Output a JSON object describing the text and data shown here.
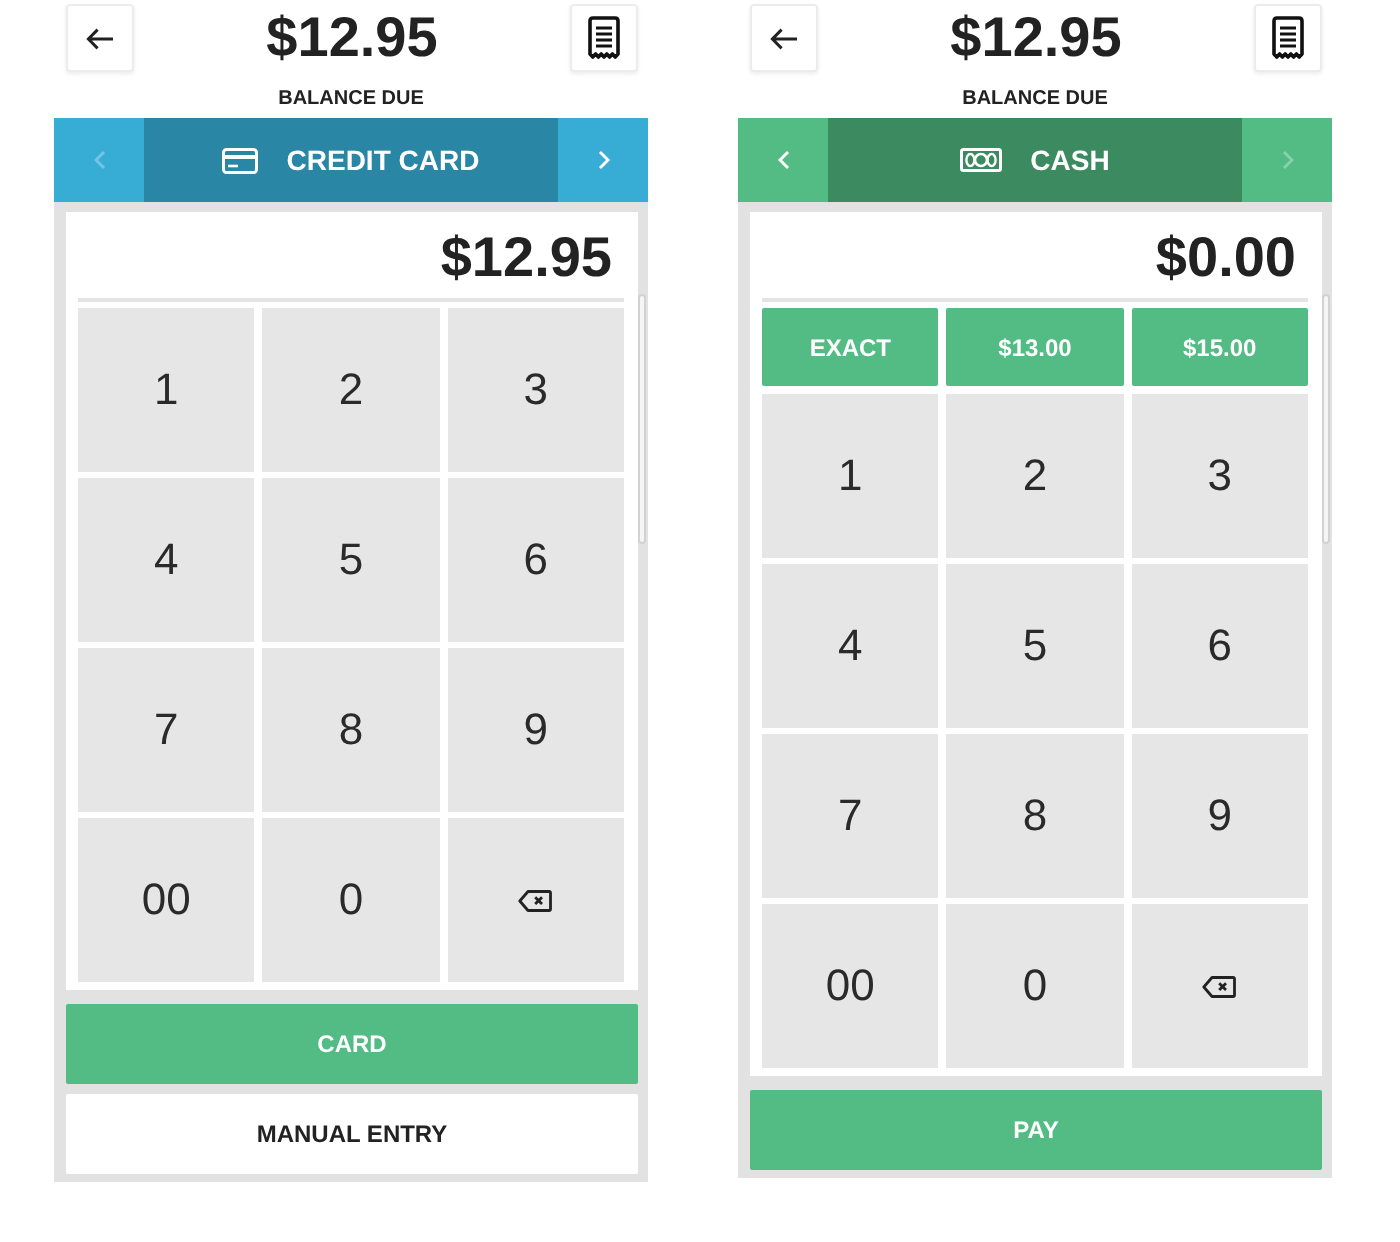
{
  "screens": [
    {
      "header": {
        "amount": "$12.95",
        "caption": "BALANCE DUE"
      },
      "method_bar": {
        "kind": "card",
        "label": "CREDIT CARD",
        "prev_disabled": true,
        "next_disabled": false
      },
      "entered_amount": "$12.95",
      "keypad": [
        {
          "kind": "digit",
          "label": "1"
        },
        {
          "kind": "digit",
          "label": "2"
        },
        {
          "kind": "digit",
          "label": "3"
        },
        {
          "kind": "digit",
          "label": "4"
        },
        {
          "kind": "digit",
          "label": "5"
        },
        {
          "kind": "digit",
          "label": "6"
        },
        {
          "kind": "digit",
          "label": "7"
        },
        {
          "kind": "digit",
          "label": "8"
        },
        {
          "kind": "digit",
          "label": "9"
        },
        {
          "kind": "digit",
          "label": "00"
        },
        {
          "kind": "digit",
          "label": "0"
        },
        {
          "kind": "backspace"
        }
      ],
      "actions": [
        {
          "kind": "primary",
          "label": "CARD"
        },
        {
          "kind": "secondary",
          "label": "MANUAL ENTRY"
        }
      ]
    },
    {
      "header": {
        "amount": "$12.95",
        "caption": "BALANCE DUE"
      },
      "method_bar": {
        "kind": "cash",
        "label": "CASH",
        "prev_disabled": false,
        "next_disabled": true
      },
      "entered_amount": "$0.00",
      "quick_amounts": [
        "EXACT",
        "$13.00",
        "$15.00"
      ],
      "keypad": [
        {
          "kind": "digit",
          "label": "1"
        },
        {
          "kind": "digit",
          "label": "2"
        },
        {
          "kind": "digit",
          "label": "3"
        },
        {
          "kind": "digit",
          "label": "4"
        },
        {
          "kind": "digit",
          "label": "5"
        },
        {
          "kind": "digit",
          "label": "6"
        },
        {
          "kind": "digit",
          "label": "7"
        },
        {
          "kind": "digit",
          "label": "8"
        },
        {
          "kind": "digit",
          "label": "9"
        },
        {
          "kind": "digit",
          "label": "00"
        },
        {
          "kind": "digit",
          "label": "0"
        },
        {
          "kind": "backspace"
        }
      ],
      "actions": [
        {
          "kind": "primary",
          "label": "PAY"
        }
      ]
    }
  ]
}
